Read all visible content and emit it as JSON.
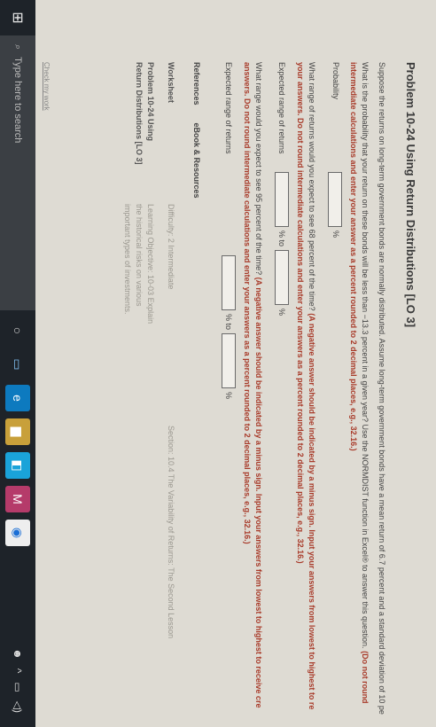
{
  "problem": {
    "title": "Problem 10-24 Using Return Distributions [LO 3]",
    "intro": "Suppose the returns on long-term government bonds are normally distributed. Assume long-term government bonds have a mean return of 6.7 percent and a standard deviation of 10 pe",
    "q1_text": "What is the probability that your return on these bonds will be less than −13.3 percent in a given year? Use the NORMDIST function in Excel® to answer this question.",
    "q1_instr": "(Do not round intermediate calculations and enter your answer as a percent rounded to 2 decimal places, e.g., 32.16.)",
    "q1_label": "Probability",
    "q2_text": "What range of returns would you expect to see 68 percent of the time?",
    "q2_instr": "(A negative answer should be indicated by a minus sign. Input your answers from lowest to highest to re your answers. Do not round intermediate calculations and enter your answers as a percent rounded to 2 decimal places, e.g., 32.16.)",
    "q2_label": "Expected range of returns",
    "q3_text": "What range would you expect to see 95 percent of the time?",
    "q3_instr": "(A negative answer should be indicated by a minus sign. Input your answers from lowest to highest to receive cre answers. Do not round intermediate calculations and enter your answers as a percent rounded to 2 decimal places, e.g., 32.16.)",
    "q3_label": "Expected range of returns",
    "pct": "%",
    "to": "% to"
  },
  "references": {
    "label": "References",
    "ebook": "eBook & Resources"
  },
  "worksheet": {
    "label": "Worksheet",
    "problem": "Problem 10-24 Using Return Distributions [LO 3]",
    "difficulty": "Difficulty: 2 Intermediate",
    "objective": "Learning Objective: 10-03 Explain the historical risks on various important types of investments.",
    "section": "Section: 10.4 The Variability of Returns: The Second Lesson"
  },
  "check_link": "Check my work",
  "taskbar": {
    "search_placeholder": "Type here to search"
  }
}
